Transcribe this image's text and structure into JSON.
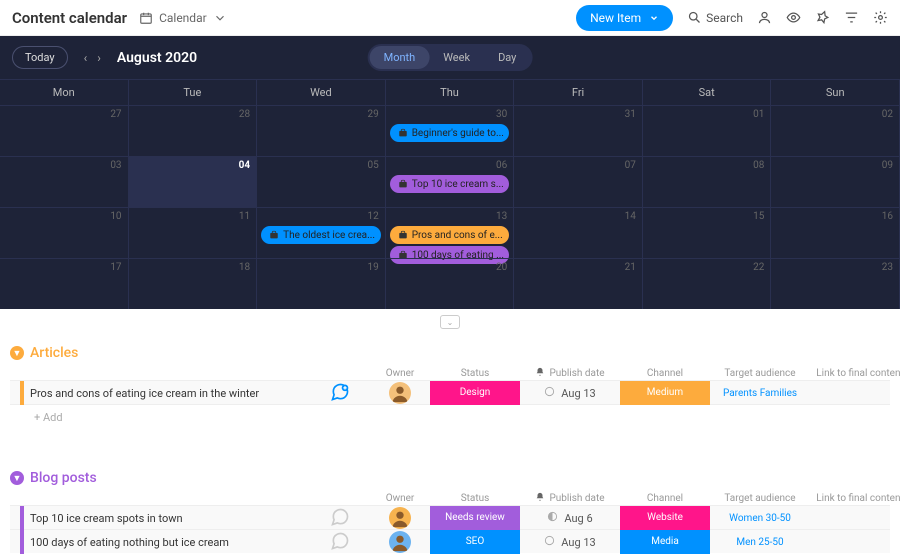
{
  "header": {
    "title": "Content calendar",
    "view_label": "Calendar",
    "new_item": "New Item",
    "search_label": "Search"
  },
  "calendar": {
    "today_label": "Today",
    "month_label": "August 2020",
    "range": {
      "month": "Month",
      "week": "Week",
      "day": "Day"
    },
    "days": [
      "Mon",
      "Tue",
      "Wed",
      "Thu",
      "Fri",
      "Sat",
      "Sun"
    ],
    "weeks": [
      {
        "cells": [
          {
            "n": "27"
          },
          {
            "n": "28"
          },
          {
            "n": "29"
          },
          {
            "n": "30",
            "ev": [
              {
                "t": "Beginner's guide to...",
                "c": "#0091ff"
              }
            ]
          },
          {
            "n": "31"
          },
          {
            "n": "01"
          },
          {
            "n": "02"
          }
        ]
      },
      {
        "cells": [
          {
            "n": "03"
          },
          {
            "n": "04",
            "today": true,
            "hl": true
          },
          {
            "n": "05"
          },
          {
            "n": "06",
            "ev": [
              {
                "t": "Top 10 ice cream s...",
                "c": "#a25ddc"
              }
            ]
          },
          {
            "n": "07"
          },
          {
            "n": "08"
          },
          {
            "n": "09"
          }
        ]
      },
      {
        "cells": [
          {
            "n": "10"
          },
          {
            "n": "11"
          },
          {
            "n": "12",
            "ev": [
              {
                "t": "The oldest ice crea...",
                "c": "#0091ff"
              }
            ]
          },
          {
            "n": "13",
            "ev": [
              {
                "t": "Pros and cons of e...",
                "c": "#fdab3d"
              },
              {
                "t": "100 days of eating ...",
                "c": "#a25ddc"
              }
            ]
          },
          {
            "n": "14"
          },
          {
            "n": "15"
          },
          {
            "n": "16"
          }
        ]
      },
      {
        "cells": [
          {
            "n": "17"
          },
          {
            "n": "18"
          },
          {
            "n": "19"
          },
          {
            "n": "20"
          },
          {
            "n": "21"
          },
          {
            "n": "22"
          },
          {
            "n": "23"
          }
        ]
      }
    ]
  },
  "groups": [
    {
      "name": "Articles",
      "color": "#fdab3d",
      "cols": [
        "",
        "",
        "Owner",
        "Status",
        "Publish date",
        "Channel",
        "Target audience",
        "Link to final content"
      ],
      "rows": [
        {
          "name": "Pros and cons of eating ice cream in the winter",
          "chat": true,
          "owner": "#f4c07a",
          "status": {
            "t": "Design",
            "c": "#ff158a"
          },
          "date": "Aug 13",
          "dateicon": "empty",
          "channel": {
            "t": "Medium",
            "c": "#fdab3d"
          },
          "aud": "Parents    Families"
        }
      ],
      "add": "+ Add"
    },
    {
      "name": "Blog posts",
      "color": "#a25ddc",
      "cols": [
        "",
        "",
        "Owner",
        "Status",
        "Publish date",
        "Channel",
        "Target audience",
        "Link to final content"
      ],
      "rows": [
        {
          "name": "Top 10 ice cream spots in town",
          "chat": false,
          "owner": "#f7b34f",
          "status": {
            "t": "Needs review",
            "c": "#a25ddc"
          },
          "date": "Aug 6",
          "dateicon": "clock",
          "channel": {
            "t": "Website",
            "c": "#ff158a"
          },
          "aud": "Women 30-50"
        },
        {
          "name": "100 days of eating nothing but ice cream",
          "chat": false,
          "owner": "#6cb3f0",
          "status": {
            "t": "SEO",
            "c": "#0091ff"
          },
          "date": "Aug 13",
          "dateicon": "empty",
          "channel": {
            "t": "Media",
            "c": "#0091ff"
          },
          "aud": "Men 25-50"
        }
      ]
    }
  ]
}
